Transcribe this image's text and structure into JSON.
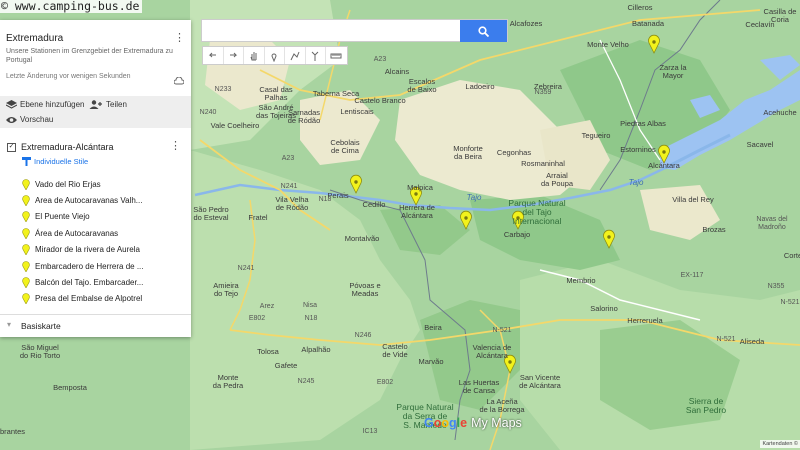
{
  "watermark": "© www.camping-bus.de",
  "panel": {
    "title": "Extremadura",
    "description": "Unsere Stationen im Grenzgebiet der Extremadura zu Portugal",
    "last_change": "Letzte Änderung vor wenigen Sekunden",
    "add_layer": "Ebene hinzufügen",
    "share": "Teilen",
    "preview": "Vorschau",
    "layer": {
      "title": "Extremadura-Alcántara",
      "styles": "Individuelle Stile",
      "places": [
        "Vado del Rio Erjas",
        "Area de Autocaravanas Valh...",
        "El Puente Viejo",
        "Área de Autocaravanas",
        "Mirador de la rivera de Aurela",
        "Embarcadero de Herrera de ...",
        "Balcón del Tajo. Embarcader...",
        "Presa del Embalse de Alpotrel"
      ]
    },
    "basemap": "Basiskarte"
  },
  "search": {
    "value": "",
    "placeholder": ""
  },
  "icons": {
    "tools": [
      "undo-icon",
      "redo-icon",
      "hand-icon",
      "marker-icon",
      "line-icon",
      "route-icon",
      "ruler-icon"
    ],
    "search": "search-icon",
    "cloud": "cloud-off-icon"
  },
  "colors": {
    "pin": "#f2f21c",
    "accent": "#3b7ded",
    "land": "#a8d4a0",
    "water": "#9dc3f2"
  },
  "map": {
    "logo_g": "Google",
    "logo_my": "My Maps",
    "credit": "Kartendaten ©",
    "labels": {
      "castelo_branco": "Castelo Branco",
      "alcains": "Alcains",
      "escalos": "Escalos\nde Baixo",
      "ladoeiro": "Ladoeiro",
      "zebreira": "Zebreira",
      "alcafozes": "Alcafozes",
      "monte_velho": "Monte Velho",
      "batanada": "Batanada",
      "zarza": "Zarza la\nMayor",
      "casal_das": "Casal das\nPalhas",
      "sao_andre": "São André\ndas Tojeiras",
      "taberna_seca": "Taberna Seca",
      "sarnadas": "Sarnadas\nde Ródão",
      "lentiscais": "Lentiscais",
      "cebolais": "Cebolais\nde Cima",
      "vale_coelheiro": "Vale Coelheiro",
      "monforte": "Monforte\nda Beira",
      "cegonhas": "Cegonhas",
      "rosmaninhal": "Rosmaninhal",
      "arraial": "Arraial\nda Poupa",
      "tegueiro": "Tegueiro",
      "estorninos": "Estorninos",
      "alcantara": "Alcántara",
      "piedras_albas": "Piedras Albas",
      "villa_del_rey": "Villa del Rey",
      "brozas": "Brozas",
      "navas": "Navas del\nMadroño",
      "acehuche": "Acehuche",
      "ceclavin": "Ceclavín",
      "cilleros": "Cilleros",
      "villa_velha": "Vila Velha\nde Ródão",
      "perais": "Perais",
      "cedillo": "Cedillo",
      "malpica": "Malpica",
      "herrera": "Herrera de\nAlcántara",
      "carbajo": "Carbajo",
      "park_tajo": "Parque Natural\ndel Tajo\nInternacional",
      "tajo": "Tajo",
      "tajo2": "Tajo",
      "sao_pedro": "São Pedro\ndo Esteval",
      "fratel": "Fratel",
      "montalvao": "Montalvão",
      "povoas": "Póvoas e\nMeadas",
      "membrio": "Membrio",
      "salorino": "Salorino",
      "herreruela": "Herreruela",
      "amieira": "Amieira\ndo Tejo",
      "arez": "Arez",
      "nisa": "Nisa",
      "beira": "Beira",
      "castelo_vide": "Castelo\nde Vide",
      "marvao": "Marvão",
      "tolosa": "Tolosa",
      "gafete": "Gafete",
      "alpalhao": "Alpalhão",
      "monte_pedra": "Monte\nda Pedra",
      "sao_miguel": "São Miguel\ndo Rio Torto",
      "bemposta": "Bemposta",
      "valencia": "Valencia de\nAlcántara",
      "san_vicente": "San Vicente\nde Alcántara",
      "las_huertas": "Las Huertas\nde Cansa",
      "la_aceña": "La Aceña\nde la Borrega",
      "park_sao": "Parque Natural\nda Serra de\nS. Mamede",
      "sierra": "Sierra de\nSan Pedro",
      "aliseda": "Aliseda",
      "corte": "Corte",
      "abrantes": "Abrantes",
      "n_521": "N-521",
      "n_521b": "N-521",
      "n_521c": "N-521",
      "a23": "A23",
      "a23b": "A23",
      "n18": "N18",
      "n18b": "N18",
      "n241": "N241",
      "n241b": "N241",
      "n246": "N246",
      "n245": "N245",
      "e802": "E802",
      "e802b": "E802",
      "ic13": "IC13",
      "n359": "N359",
      "n233": "N233",
      "n240": "N240",
      "ex117": "EX-117",
      "n355": "N355",
      "casilla": "Casilla de\nCoria",
      "sacavel": "Sacavel"
    },
    "pins": [
      {
        "name": "Zarza la Mayor"
      },
      {
        "name": "Alcántara"
      },
      {
        "name": "Perais"
      },
      {
        "name": "Herrera de Alcántara"
      },
      {
        "name": "Carbajo"
      },
      {
        "name": "Embarcadero"
      },
      {
        "name": "Membrio"
      },
      {
        "name": "Valencia de Alcántara"
      }
    ]
  }
}
